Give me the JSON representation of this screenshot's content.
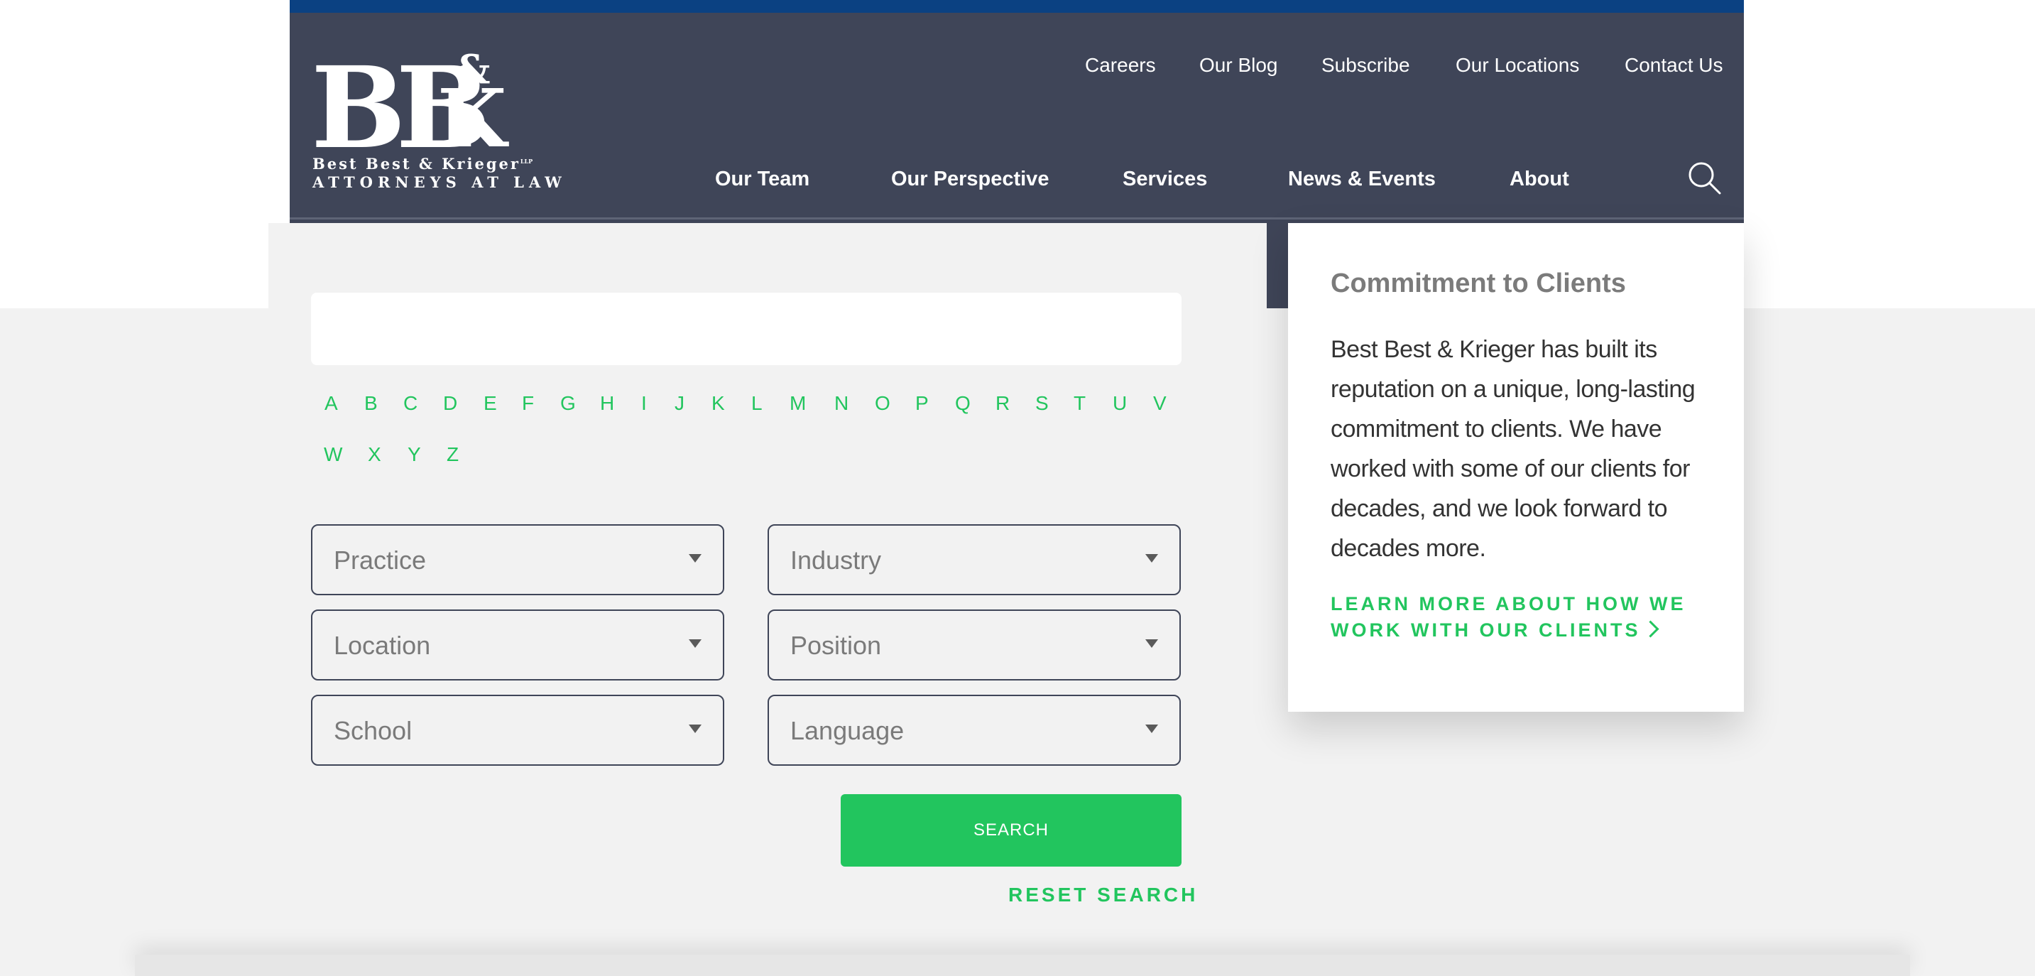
{
  "brand": {
    "logo_letters_b": "BB",
    "logo_letters_amp": "&",
    "logo_letters_k": "K",
    "logo_line1": "Best Best & Krieger",
    "logo_line1_suffix": "LLP",
    "logo_line2": "ATTORNEYS AT LAW",
    "colors": {
      "header_bg": "#3f4558",
      "top_stripe": "#0b4182",
      "accent_green": "#22c55e",
      "page_bg": "#f2f2f2"
    }
  },
  "utility_nav": {
    "items": [
      "Careers",
      "Our Blog",
      "Subscribe",
      "Our Locations",
      "Contact Us"
    ]
  },
  "main_nav": {
    "items": [
      "Our Team",
      "Our Perspective",
      "Services",
      "News & Events",
      "About"
    ],
    "search_icon": "search-icon"
  },
  "search": {
    "name_value": "",
    "alphabet": [
      "A",
      "B",
      "C",
      "D",
      "E",
      "F",
      "G",
      "H",
      "I",
      "J",
      "K",
      "L",
      "M",
      "N",
      "O",
      "P",
      "Q",
      "R",
      "S",
      "T",
      "U",
      "V",
      "W",
      "X",
      "Y",
      "Z"
    ],
    "filters": {
      "practice": "Practice",
      "industry": "Industry",
      "location": "Location",
      "position": "Position",
      "school": "School",
      "language": "Language"
    },
    "search_button": "SEARCH",
    "reset_link": "RESET SEARCH"
  },
  "sidebar_card": {
    "title": "Commitment to Clients",
    "body": "Best Best & Krieger has built its reputation on a unique, long-lasting commitment to clients. We have worked with some of our clients for decades, and we look forward to decades more.",
    "link_text": "LEARN MORE ABOUT HOW WE WORK WITH OUR CLIENTS",
    "link_icon": "chevron-right-icon"
  }
}
